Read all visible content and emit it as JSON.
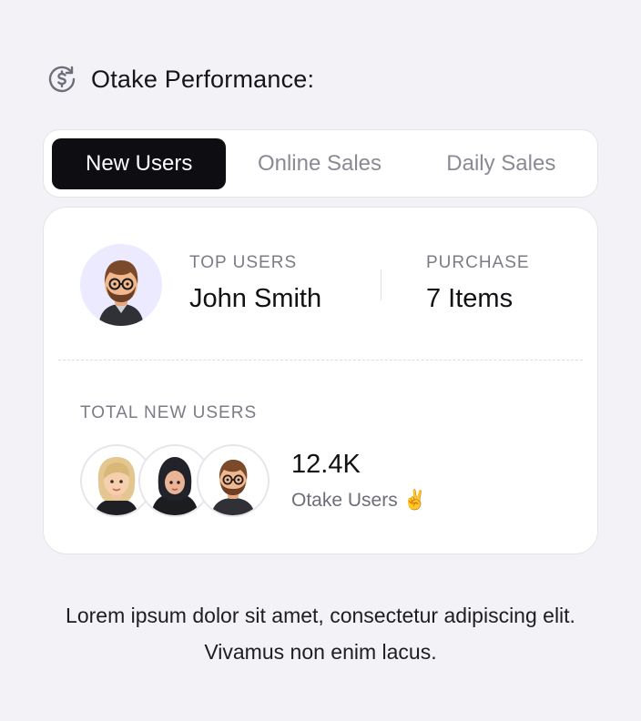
{
  "header": {
    "title": "Otake Performance:",
    "icon": "dollar-refresh-icon"
  },
  "tabs": [
    {
      "label": "New Users",
      "active": true
    },
    {
      "label": "Online Sales",
      "active": false
    },
    {
      "label": "Daily Sales",
      "active": false
    }
  ],
  "card": {
    "top_user": {
      "label": "TOP USERS",
      "value": "John Smith"
    },
    "purchase": {
      "label": "PURCHASE",
      "value": "7 Items"
    },
    "total": {
      "label": "TOTAL NEW USERS",
      "count": "12.4K",
      "subtitle": "Otake Users ✌️"
    }
  },
  "footer": {
    "text": "Lorem ipsum dolor sit amet, consectetur adipiscing elit. Vivamus non enim lacus."
  },
  "colors": {
    "active_tab_bg": "#0e0e12",
    "avatar_bg": "#eceaff"
  }
}
